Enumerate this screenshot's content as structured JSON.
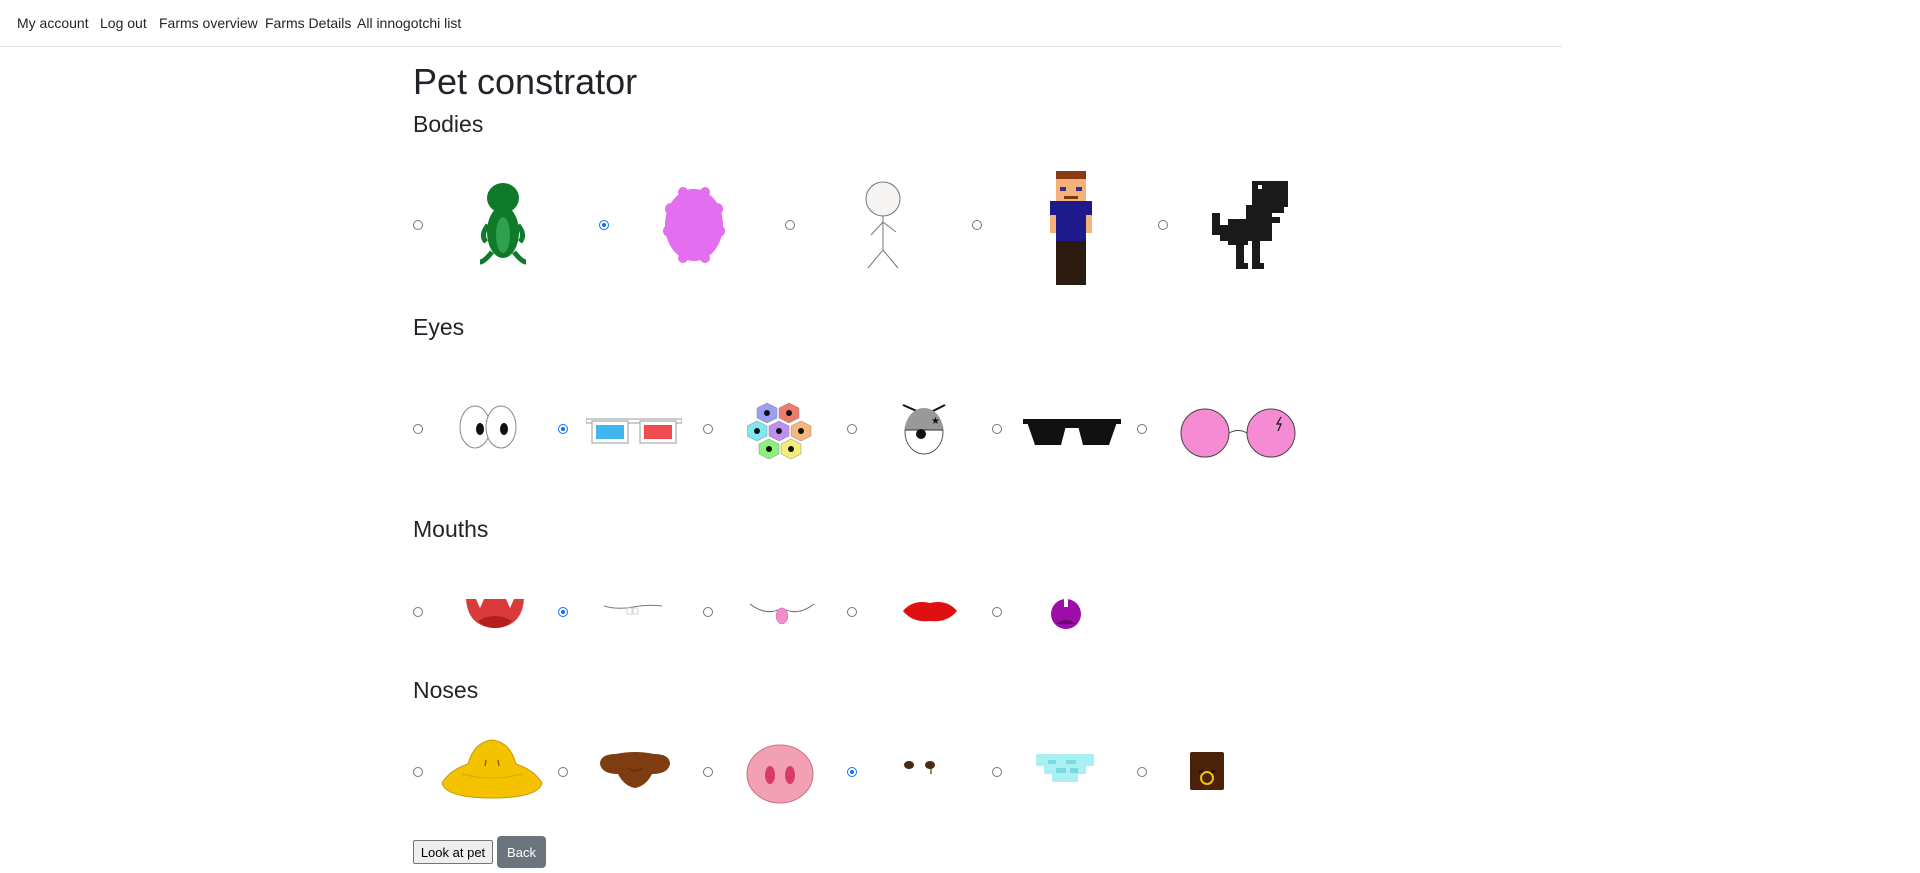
{
  "nav": {
    "my_account": "My account",
    "log_out": "Log out",
    "farms_overview": "Farms overview",
    "farms_details": "Farms Details",
    "all_innogotchi": "All innogotchi list"
  },
  "page_title": "Pet constrator",
  "sections": {
    "bodies": {
      "title": "Bodies",
      "options": [
        {
          "icon": "green-frog-body-icon",
          "selected": false
        },
        {
          "icon": "pink-fluffy-body-icon",
          "selected": true
        },
        {
          "icon": "stick-figure-body-icon",
          "selected": false
        },
        {
          "icon": "pixel-man-body-icon",
          "selected": false
        },
        {
          "icon": "pixel-dino-body-icon",
          "selected": false
        }
      ]
    },
    "eyes": {
      "title": "Eyes",
      "options": [
        {
          "icon": "cartoon-eyes-icon",
          "selected": false
        },
        {
          "icon": "3d-glasses-icon",
          "selected": true
        },
        {
          "icon": "insect-compound-eyes-icon",
          "selected": false
        },
        {
          "icon": "pirate-eye-icon",
          "selected": false
        },
        {
          "icon": "black-sunglasses-icon",
          "selected": false
        },
        {
          "icon": "pink-round-glasses-icon",
          "selected": false
        }
      ]
    },
    "mouths": {
      "title": "Mouths",
      "options": [
        {
          "icon": "fanged-mouth-icon",
          "selected": false
        },
        {
          "icon": "thin-line-mouth-icon",
          "selected": true
        },
        {
          "icon": "tongue-out-mouth-icon",
          "selected": false
        },
        {
          "icon": "red-lips-icon",
          "selected": false
        },
        {
          "icon": "purple-round-mouth-icon",
          "selected": false
        }
      ]
    },
    "noses": {
      "title": "Noses",
      "options": [
        {
          "icon": "duck-beak-nose-icon",
          "selected": false
        },
        {
          "icon": "brown-nose-icon",
          "selected": false
        },
        {
          "icon": "pig-snout-icon",
          "selected": false
        },
        {
          "icon": "small-nostrils-icon",
          "selected": true
        },
        {
          "icon": "diamond-nose-icon",
          "selected": false
        },
        {
          "icon": "nose-ring-icon",
          "selected": false
        }
      ]
    }
  },
  "buttons": {
    "look": "Look at pet",
    "back": "Back"
  },
  "colors": {
    "radio_selected": "#0d6efd",
    "back_button": "#6c757d",
    "nav_border": "#dee2e6"
  }
}
